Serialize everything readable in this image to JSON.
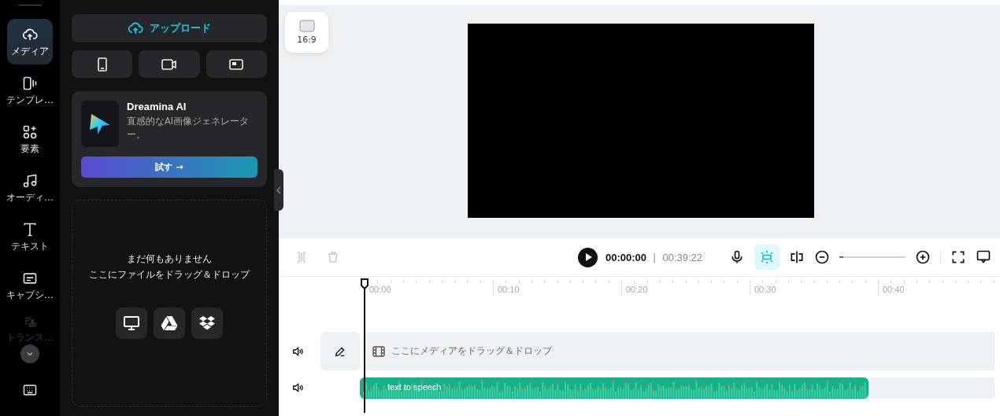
{
  "rail": {
    "items": [
      {
        "label": "メディア",
        "selected": true,
        "faded": false
      },
      {
        "label": "テンプレ…",
        "selected": false,
        "faded": false
      },
      {
        "label": "要素",
        "selected": false,
        "faded": false
      },
      {
        "label": "オーディ…",
        "selected": false,
        "faded": false
      },
      {
        "label": "テキスト",
        "selected": false,
        "faded": false
      },
      {
        "label": "キャプシ…",
        "selected": false,
        "faded": false
      },
      {
        "label": "トランス…",
        "selected": false,
        "faded": true
      }
    ]
  },
  "panel": {
    "upload_button": "アップロード",
    "promo": {
      "title": "Dreamina AI",
      "description": "直感的なAI画像ジェネレーター。",
      "button": "試す →"
    },
    "dropzone": {
      "title": "まだ何もありません",
      "hint": "ここにファイルをドラッグ＆ドロップ"
    }
  },
  "preview": {
    "aspect_ratio": "16:9"
  },
  "toolbar": {
    "current_time": "00:00:00",
    "separator": "|",
    "duration": "00:39:22",
    "auto_caption_active": true,
    "zoom": {
      "level": 0.06
    }
  },
  "timeline": {
    "ruler": [
      "00:00",
      "00:10",
      "00:20",
      "00:30",
      "00:40"
    ],
    "tracks": [
      {
        "kind": "video",
        "placeholder": "ここにメディアをドラッグ＆ドロップ"
      },
      {
        "kind": "audio",
        "clip": "text to speech"
      }
    ]
  }
}
